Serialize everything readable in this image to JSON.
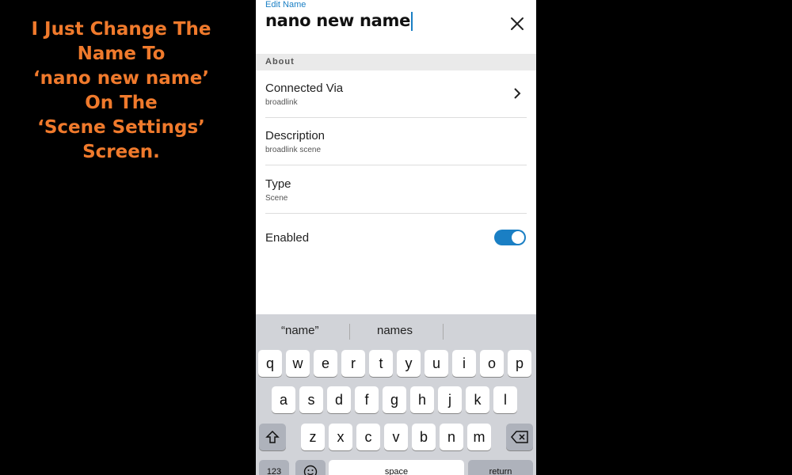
{
  "caption": [
    "I Just Change The",
    "Name To",
    "‘nano new name’",
    "On The",
    "‘Scene Settings’",
    "Screen."
  ],
  "header": {
    "edit_label": "Edit Name",
    "name_value": "nano new name"
  },
  "about": {
    "section_label": "About",
    "connected_via": {
      "title": "Connected Via",
      "value": "broadlink"
    },
    "description": {
      "title": "Description",
      "value": "broadlink scene"
    },
    "type": {
      "title": "Type",
      "value": "Scene"
    },
    "enabled": {
      "title": "Enabled",
      "on": true
    }
  },
  "keyboard": {
    "suggestions": [
      "“name”",
      "names"
    ],
    "row1": [
      "q",
      "w",
      "e",
      "r",
      "t",
      "y",
      "u",
      "i",
      "o",
      "p"
    ],
    "row2": [
      "a",
      "s",
      "d",
      "f",
      "g",
      "h",
      "j",
      "k",
      "l"
    ],
    "row3": [
      "z",
      "x",
      "c",
      "v",
      "b",
      "n",
      "m"
    ],
    "bottom": {
      "numbers": "123",
      "space": "space",
      "return": "return"
    }
  },
  "colors": {
    "accent": "#1a7fc4",
    "caption": "#f07a2c"
  }
}
